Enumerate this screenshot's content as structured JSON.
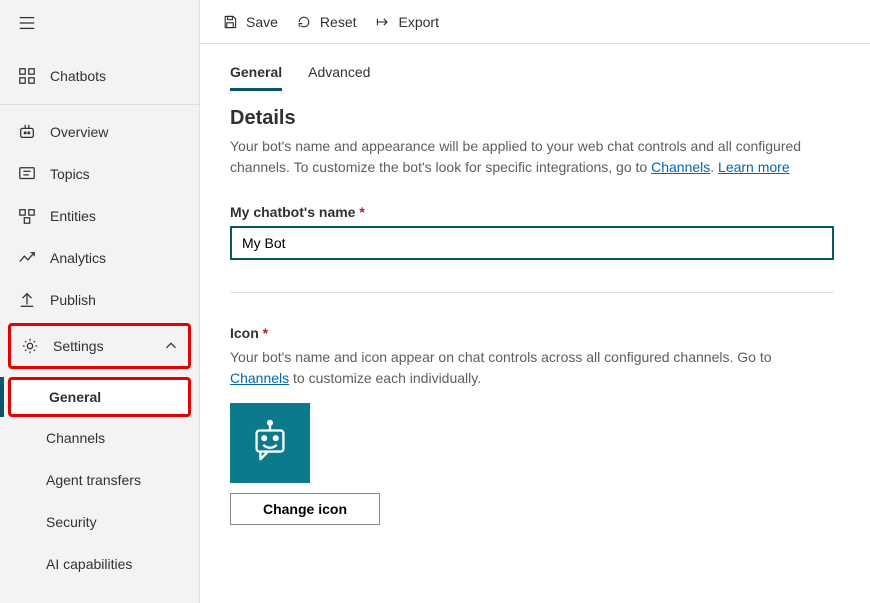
{
  "sidebar": {
    "chatbots": "Chatbots",
    "overview": "Overview",
    "topics": "Topics",
    "entities": "Entities",
    "analytics": "Analytics",
    "publish": "Publish",
    "settings": "Settings",
    "settings_children": {
      "general": "General",
      "channels": "Channels",
      "agent_transfers": "Agent transfers",
      "security": "Security",
      "ai_capabilities": "AI capabilities"
    }
  },
  "toolbar": {
    "save": "Save",
    "reset": "Reset",
    "export": "Export"
  },
  "tabs": {
    "general": "General",
    "advanced": "Advanced"
  },
  "details": {
    "heading": "Details",
    "description_part1": "Your bot's name and appearance will be applied to your web chat controls and all configured channels. To customize the bot's look for specific integrations, go to ",
    "channels_link": "Channels",
    "punct": ". ",
    "learn_more": "Learn more"
  },
  "name_field": {
    "label": "My chatbot's name",
    "value": "My Bot"
  },
  "icon_section": {
    "label": "Icon",
    "desc_part1": "Your bot's name and icon appear on chat controls across all configured channels. Go to ",
    "channels_link": "Channels",
    "desc_part2": " to customize each individually.",
    "change_button": "Change icon"
  }
}
